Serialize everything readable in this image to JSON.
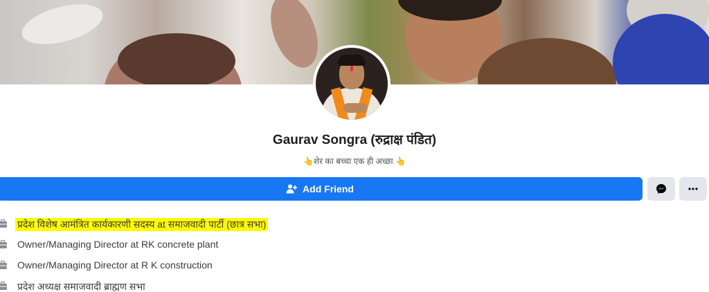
{
  "profile": {
    "name": "Gaurav Songra (रुद्राक्ष पंडित)",
    "bio": "👆शेर का बच्चा एक ही अच्छा 👆"
  },
  "actions": {
    "add_friend_label": "Add Friend",
    "add_friend_icon": "add-friend-icon",
    "messenger_icon": "messenger-icon",
    "more_icon": "more-dots-icon"
  },
  "work": [
    {
      "text": "प्रदेश विशेष आमंत्रित कार्यकारणी सदस्य at समाजवादी पार्टी (छात्र सभा)",
      "highlighted": true
    },
    {
      "text": "Owner/Managing Director at RK concrete plant",
      "highlighted": false
    },
    {
      "text": "Owner/Managing Director at R K construction",
      "highlighted": false
    },
    {
      "text": "प्रदेश अध्यक्ष समाजवादी ब्राह्मण सभा",
      "highlighted": false
    }
  ],
  "colors": {
    "primary": "#1877f2",
    "secondary_button": "#e4e6eb",
    "highlight": "#fffb00"
  }
}
